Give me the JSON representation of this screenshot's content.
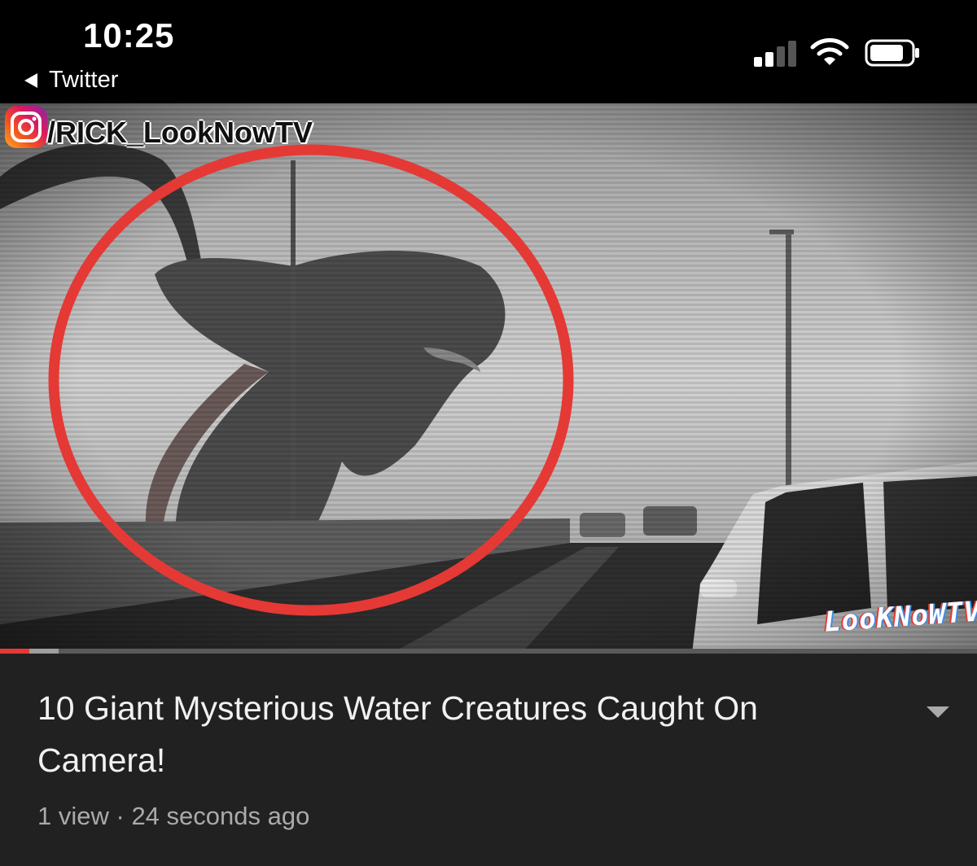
{
  "status_bar": {
    "time": "10:25",
    "back_label": "Twitter",
    "icons": [
      "signal-icon",
      "wifi-icon",
      "battery-icon"
    ]
  },
  "video": {
    "overlay_handle": "/RICK_LookNowTV",
    "overlay_icon": "instagram-icon",
    "watermark": "LooKNoWTV",
    "progress_fraction": 0.03,
    "buffer_fraction": 0.06,
    "accent_color": "#e53935"
  },
  "details": {
    "title": "10 Giant Mysterious Water Creatures Caught On Camera!",
    "views": "1 view",
    "separator": " · ",
    "age": "24 seconds ago",
    "expand_icon": "chevron-down-icon"
  }
}
